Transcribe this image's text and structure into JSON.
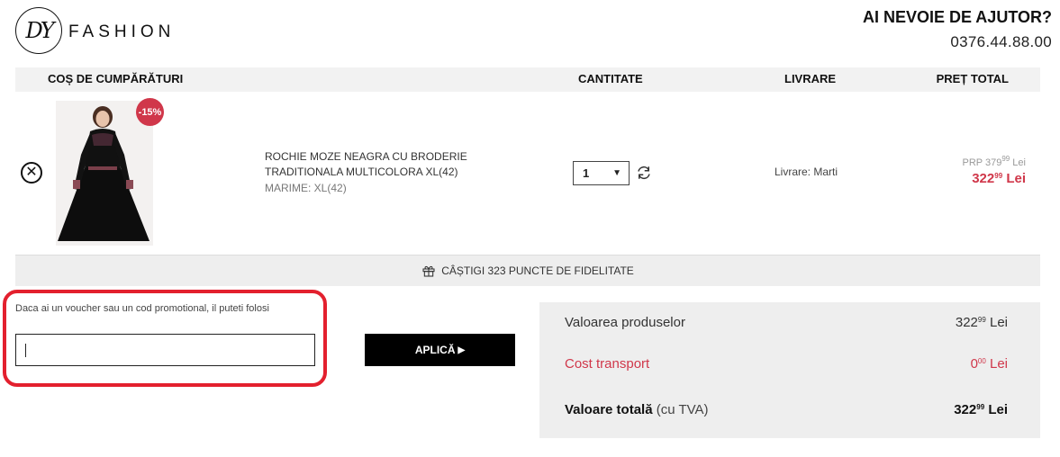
{
  "brand": {
    "monogram": "DY",
    "name": "FASHION"
  },
  "help": {
    "title": "AI NEVOIE DE AJUTOR?",
    "phone": "0376.44.88.00"
  },
  "columns": {
    "cart": "COȘ DE CUMPĂRĂTURI",
    "qty": "CANTITATE",
    "delivery": "LIVRARE",
    "total": "PREȚ TOTAL"
  },
  "product": {
    "discount_badge": "-15%",
    "name": "ROCHIE MOZE NEAGRA CU BRODERIE TRADITIONALA MULTICOLORA XL(42)",
    "size": "MARIME: XL(42)",
    "quantity": "1",
    "delivery": "Livrare: Marti",
    "prp_label": "PRP 379",
    "prp_cents": "99",
    "prp_currency": " Lei",
    "price_int": "322",
    "price_cents": "99",
    "price_currency": " Lei"
  },
  "loyalty": {
    "text": "CÂȘTIGI 323 PUNCTE DE FIDELITATE"
  },
  "voucher": {
    "label": "Daca ai un voucher sau un cod promotional, il puteti folosi",
    "value": "",
    "apply_label": "APLICĂ"
  },
  "summary": {
    "products_label": "Valoarea produselor",
    "products_int": "322",
    "products_cents": "99",
    "products_currency": " Lei",
    "transport_label": "Cost transport",
    "transport_int": "0",
    "transport_cents": "00",
    "transport_currency": " Lei",
    "total_label": "Valoare totală",
    "total_note": " (cu TVA)",
    "total_int": "322",
    "total_cents": "99",
    "total_currency": " Lei"
  },
  "colors": {
    "accent_red": "#d0374a",
    "highlight_frame": "#e3202e",
    "button_black": "#000000"
  },
  "icons": {
    "remove": "close-circle-icon",
    "refresh": "refresh-icon",
    "gift": "gift-icon",
    "dropdown": "caret-down-icon",
    "apply_arrow": "caret-right-icon"
  }
}
